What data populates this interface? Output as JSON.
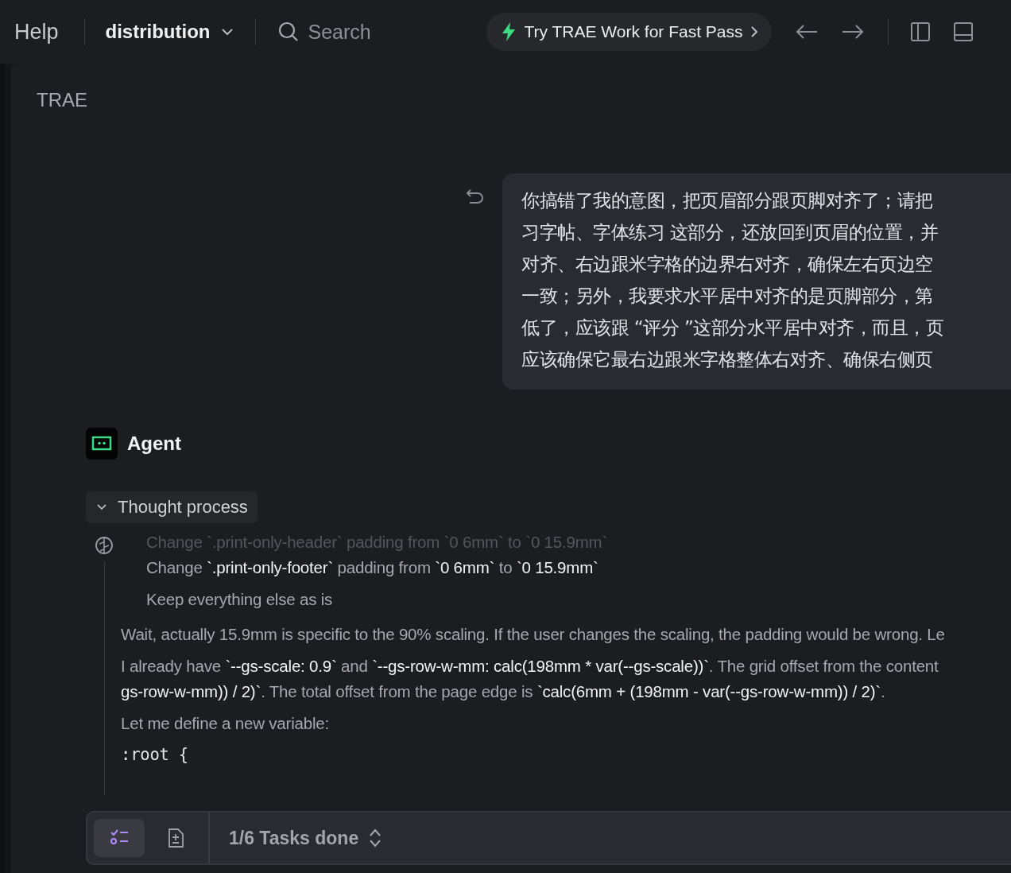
{
  "topbar": {
    "menu": "Help",
    "project": "distribution",
    "search": {
      "placeholder": "Search"
    },
    "promo": "Try TRAE Work for Fast Pass"
  },
  "panel": {
    "title": "TRAE"
  },
  "user_message": {
    "lines": [
      "你搞错了我的意图，把页眉部分跟页脚对齐了；请把",
      "习字帖、字体练习 这部分，还放回到页眉的位置，并",
      "对齐、右边跟米字格的边界右对齐，确保左右页边空",
      "一致；另外，我要求水平居中对齐的是页脚部分，第",
      "低了，应该跟 “评分 ”这部分水平居中对齐，而且，页",
      "应该确保它最右边跟米字格整体右对齐、确保右侧页"
    ]
  },
  "agent": {
    "name": "Agent"
  },
  "thought": {
    "label": "Thought process",
    "expanded": true,
    "items": [
      {
        "kind": "step",
        "dimmed": true,
        "lines": [
          "Change **`.print-only-header`** padding from **`0 6mm`** to **`0 15.9mm`**"
        ]
      },
      {
        "kind": "step",
        "dimmed": false,
        "lines": [
          "Change **`.print-only-footer`** padding from **`0 6mm`** to **`0 15.9mm`**"
        ]
      },
      {
        "kind": "step",
        "dimmed": false,
        "lines": [
          "Keep everything else as is"
        ]
      },
      {
        "kind": "para",
        "dimmed": false,
        "lines": [
          "Wait, actually 15.9mm is specific to the 90% scaling. If the user changes the scaling, the padding would be wrong. Le"
        ]
      },
      {
        "kind": "para",
        "dimmed": false,
        "lines": [
          "I already have **`--gs-scale: 0.9`** and **`--gs-row-w-mm: calc(198mm * var(--gs-scale))`**. The grid offset from the content",
          "**gs-row-w-mm)) / 2)`**. The total offset from the page edge is **`calc(6mm + (198mm - var(--gs-row-w-mm)) / 2)`**."
        ]
      },
      {
        "kind": "para",
        "dimmed": false,
        "lines": [
          "Let me define a new variable:"
        ]
      },
      {
        "kind": "code",
        "dimmed": false,
        "lines": [
          ":root {"
        ]
      }
    ]
  },
  "taskbar": {
    "tabs": [
      {
        "kind": "checklist",
        "selected": true
      },
      {
        "kind": "document",
        "selected": false
      }
    ],
    "status": "1/6 Tasks done"
  }
}
